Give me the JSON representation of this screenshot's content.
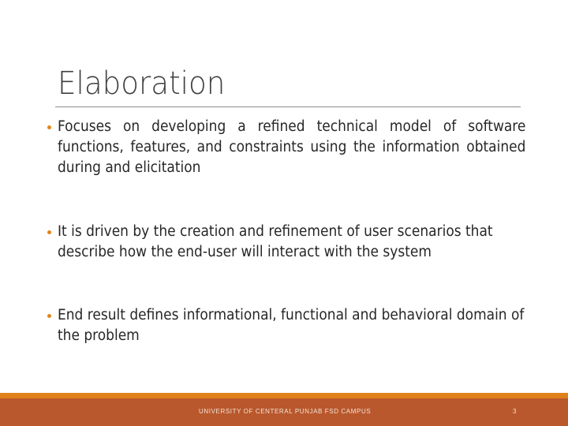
{
  "slide": {
    "title": "Elaboration",
    "bullets": [
      {
        "text": "Focuses on developing a refined technical model of software functions, features, and constraints using the information obtained during and elicitation"
      },
      {
        "text": "It is driven by the creation and refinement of user scenarios that describe how the end-user will interact with the system"
      },
      {
        "text": "End result defines informational, functional and behavioral domain of the problem"
      }
    ],
    "bullet_icon": "bullet-dot-icon"
  },
  "footer": {
    "text": "UNIVERSITY OF CENTERAL PUNJAB FSD CAMPUS",
    "page_number": "3"
  },
  "colors": {
    "accent": "#e0861a",
    "footer_band": "#b9582c",
    "footer_strip": "#e0821c",
    "title": "#404040",
    "body_text": "#262626"
  }
}
